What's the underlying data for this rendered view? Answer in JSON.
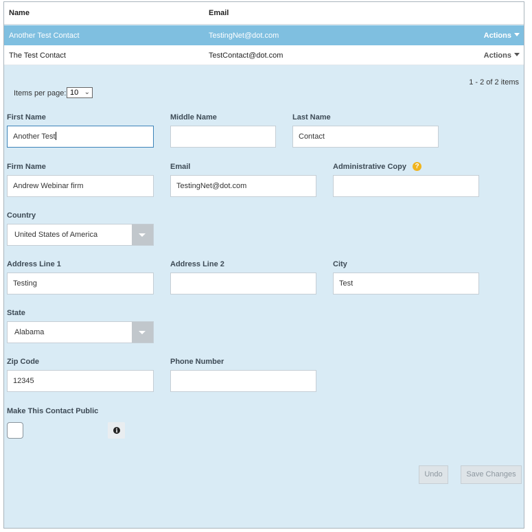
{
  "grid": {
    "columns": {
      "name": "Name",
      "email": "Email"
    },
    "rows": [
      {
        "name": "Another Test Contact",
        "email": "TestingNet@dot.com",
        "actions": "Actions",
        "selected": true
      },
      {
        "name": "The Test Contact",
        "email": "TestContact@dot.com",
        "actions": "Actions",
        "selected": false
      }
    ],
    "pager_info": "1 - 2 of 2 items",
    "items_per_page_label": "Items per page:",
    "items_per_page_value": "10"
  },
  "form": {
    "first_name": {
      "label": "First Name",
      "value": "Another Test"
    },
    "middle_name": {
      "label": "Middle Name",
      "value": ""
    },
    "last_name": {
      "label": "Last Name",
      "value": "Contact"
    },
    "firm_name": {
      "label": "Firm Name",
      "value": "Andrew Webinar firm"
    },
    "email": {
      "label": "Email",
      "value": "TestingNet@dot.com"
    },
    "admin_copy": {
      "label": "Administrative Copy",
      "value": "",
      "help_icon": "question-circle-icon"
    },
    "country": {
      "label": "Country",
      "value": "United States of America"
    },
    "address1": {
      "label": "Address Line 1",
      "value": "Testing"
    },
    "address2": {
      "label": "Address Line 2",
      "value": ""
    },
    "city": {
      "label": "City",
      "value": "Test"
    },
    "state": {
      "label": "State",
      "value": "Alabama"
    },
    "zip": {
      "label": "Zip Code",
      "value": "12345"
    },
    "phone": {
      "label": "Phone Number",
      "value": ""
    },
    "public": {
      "label": "Make This Contact Public",
      "checked": false,
      "info_icon": "info-icon"
    }
  },
  "buttons": {
    "undo": "Undo",
    "save": "Save Changes"
  },
  "colors": {
    "panel_bg": "#d9ebf5",
    "selected_row": "#7fbfe0",
    "help_icon": "#f0b41e"
  }
}
